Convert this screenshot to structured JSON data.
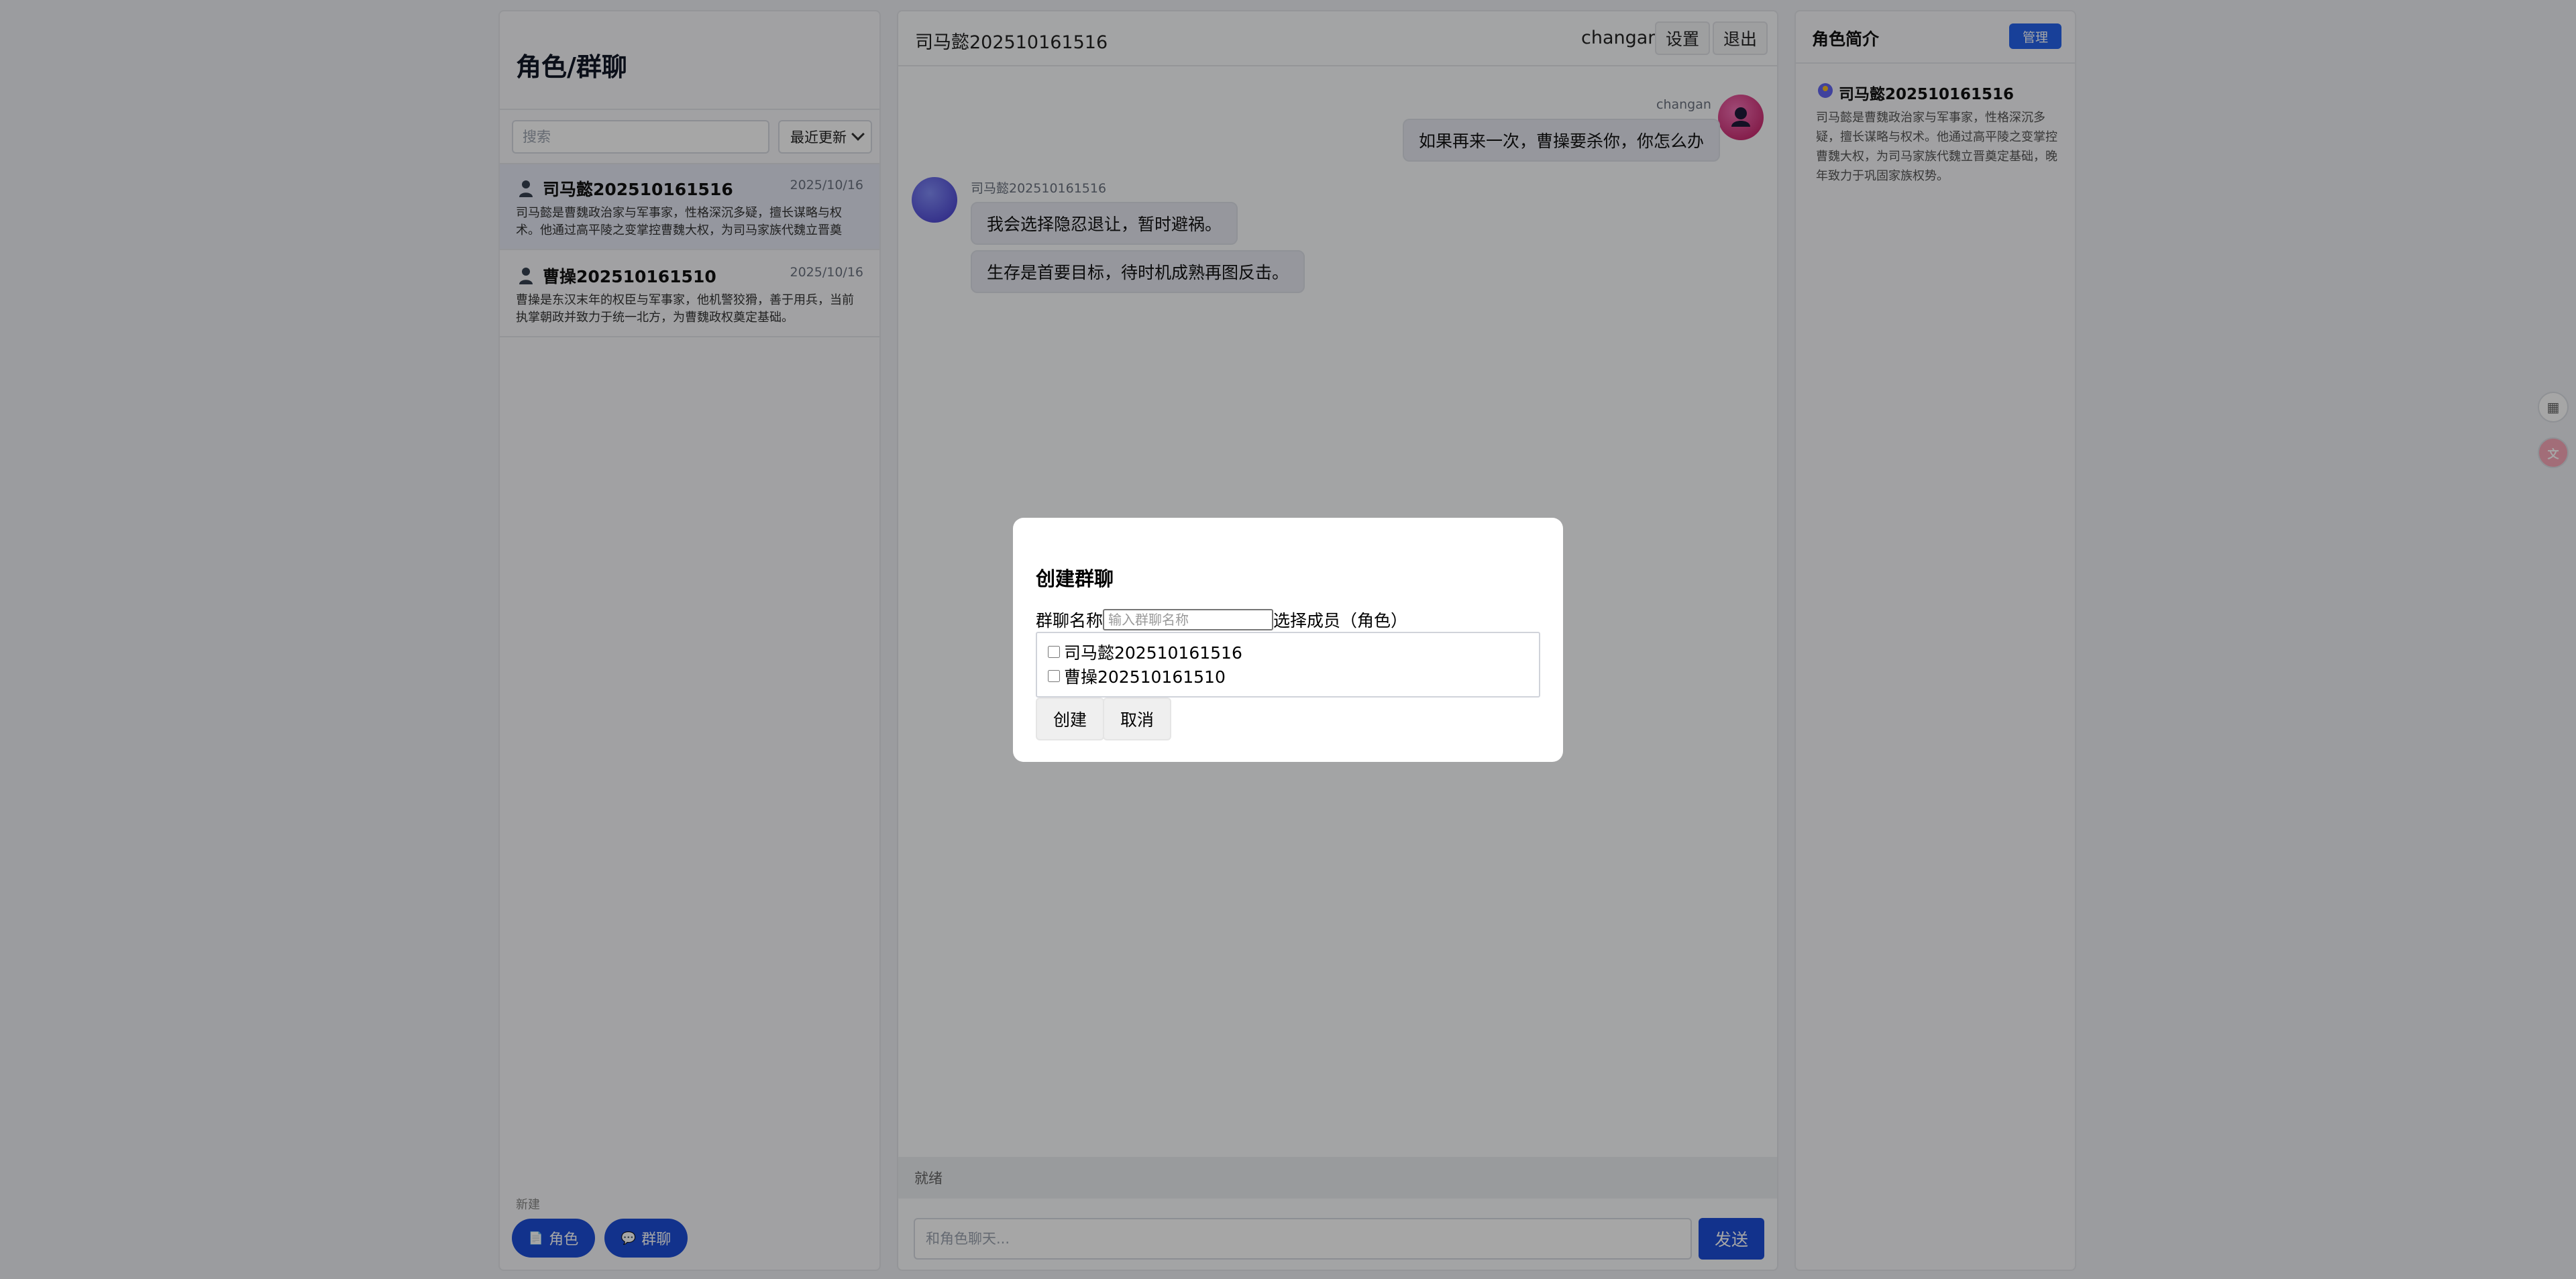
{
  "left": {
    "title": "角色/群聊",
    "search_placeholder": "搜索",
    "sort_label": "最近更新",
    "roles": [
      {
        "name": "司马懿202510161516",
        "date": "2025/10/16",
        "desc": "司马懿是曹魏政治家与军事家，性格深沉多疑，擅长谋略与权术。他通过高平陵之变掌控曹魏大权，为司马家族代魏立晋奠定..."
      },
      {
        "name": "曹操202510161510",
        "date": "2025/10/16",
        "desc": "曹操是东汉末年的权臣与军事家，他机警狡猾，善于用兵，当前执掌朝政并致力于统一北方，为曹魏政权奠定基础。"
      }
    ],
    "new_label": "新建",
    "btn_role": "角色",
    "btn_group": "群聊"
  },
  "chat": {
    "title": "司马懿202510161516",
    "username": "changan",
    "settings_label": "设置",
    "logout_label": "退出",
    "user_msg_name": "changan",
    "user_msg": "如果再来一次，曹操要杀你，你怎么办",
    "bot_name": "司马懿202510161516",
    "bot_msgs": [
      "我会选择隐忍退让，暂时避祸。",
      "生存是首要目标，待时机成熟再图反击。"
    ],
    "status": "就绪",
    "input_placeholder": "和角色聊天...",
    "send_label": "发送"
  },
  "right": {
    "title": "角色简介",
    "manage_label": "管理",
    "name": "司马懿202510161516",
    "desc": "司马懿是曹魏政治家与军事家，性格深沉多疑，擅长谋略与权术。他通过高平陵之变掌控曹魏大权，为司马家族代魏立晋奠定基础，晚年致力于巩固家族权势。"
  },
  "modal": {
    "title": "创建群聊",
    "name_label": "群聊名称",
    "name_placeholder": "输入群聊名称",
    "members_label": "选择成员（角色）",
    "members": [
      "司马懿202510161516",
      "曹操202510161510"
    ],
    "create_label": "创建",
    "cancel_label": "取消"
  },
  "colors": {
    "accent": "#1d4ed8",
    "manage": "#2563eb"
  },
  "icons": [
    "person-icon",
    "document-icon",
    "chat-bubble-icon",
    "grid-icon",
    "translate-icon"
  ]
}
